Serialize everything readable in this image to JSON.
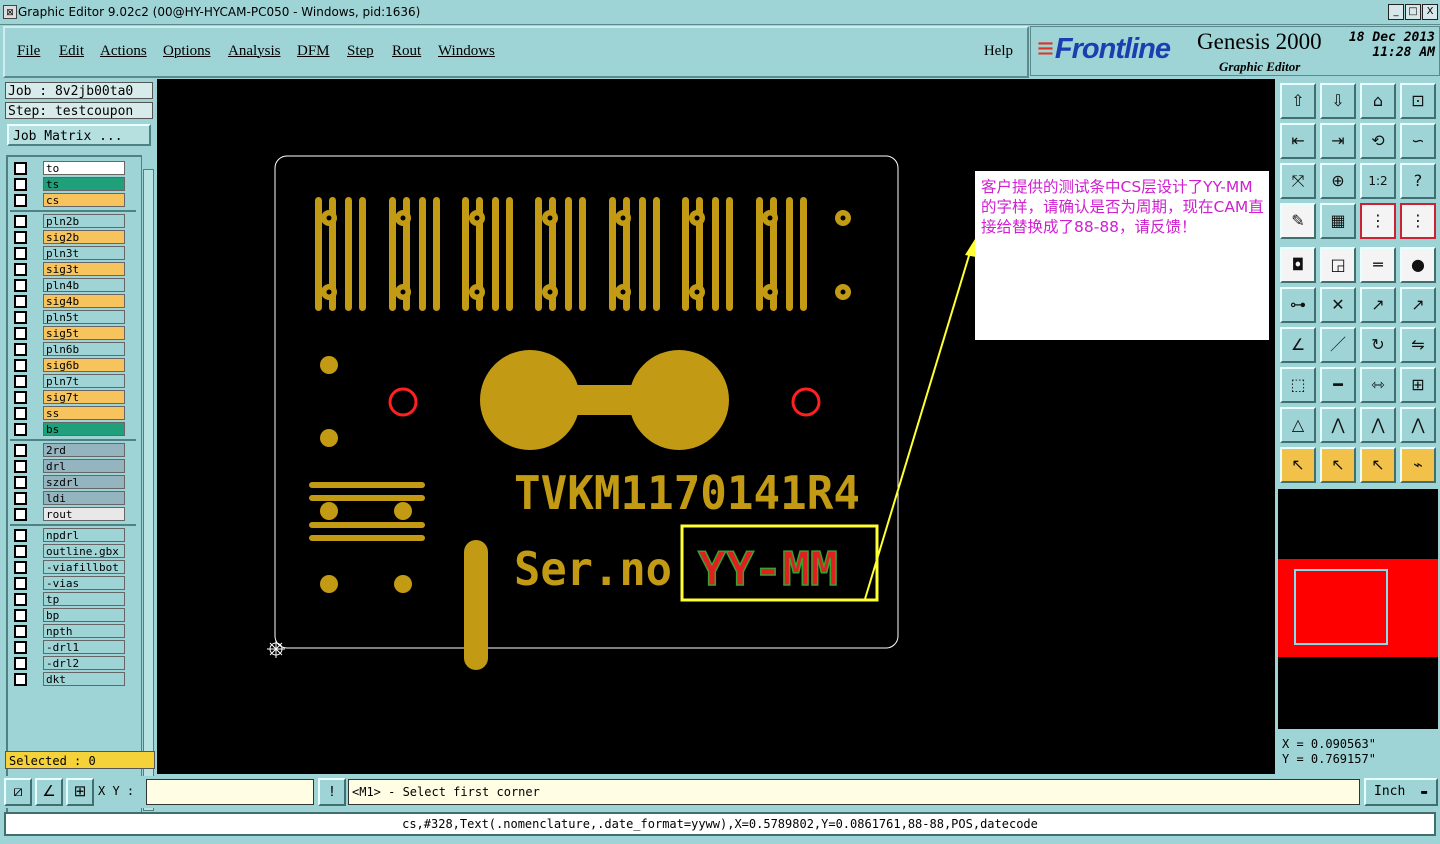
{
  "window": {
    "title": "Graphic Editor 9.02c2 (00@HY-HYCAM-PC050 - Windows, pid:1636)",
    "controls": [
      "_",
      "□",
      "X"
    ]
  },
  "menu": {
    "items": [
      "File",
      "Edit",
      "Actions",
      "Options",
      "Analysis",
      "DFM",
      "Step",
      "Rout",
      "Windows"
    ],
    "help": "Help"
  },
  "brand": {
    "logo": "Frontline",
    "product": "Genesis 2000",
    "subtitle": "Graphic Editor",
    "date": "18 Dec 2013",
    "time": "11:28 AM"
  },
  "job": {
    "job_line": "Job : 8v2jb00ta0",
    "step_line": "Step: testcoupon",
    "matrix_button": "Job Matrix ..."
  },
  "layers": [
    {
      "name": "to",
      "color": "#ffffff"
    },
    {
      "name": "ts",
      "color": "#1fa07a"
    },
    {
      "name": "cs",
      "color": "#f6c35c"
    },
    {
      "name": "pln2b",
      "color": "#9fd4d6"
    },
    {
      "name": "sig2b",
      "color": "#f6c35c"
    },
    {
      "name": "pln3t",
      "color": "#9fd4d6"
    },
    {
      "name": "sig3t",
      "color": "#f6c35c"
    },
    {
      "name": "pln4b",
      "color": "#9fd4d6"
    },
    {
      "name": "sig4b",
      "color": "#f6c35c"
    },
    {
      "name": "pln5t",
      "color": "#9fd4d6"
    },
    {
      "name": "sig5t",
      "color": "#f6c35c"
    },
    {
      "name": "pln6b",
      "color": "#9fd4d6"
    },
    {
      "name": "sig6b",
      "color": "#f6c35c"
    },
    {
      "name": "pln7t",
      "color": "#9fd4d6"
    },
    {
      "name": "sig7t",
      "color": "#f6c35c"
    },
    {
      "name": "ss",
      "color": "#f6c35c"
    },
    {
      "name": "bs",
      "color": "#1fa07a"
    },
    {
      "name": "2rd",
      "color": "#94b5bf"
    },
    {
      "name": "drl",
      "color": "#94b5bf"
    },
    {
      "name": "szdrl",
      "color": "#94b5bf"
    },
    {
      "name": "ldi",
      "color": "#94b5bf"
    },
    {
      "name": "rout",
      "color": "#e8e8e8"
    },
    {
      "name": "npdrl",
      "color": "#9fd4d6"
    },
    {
      "name": "outline.gbx",
      "color": "#9fd4d6"
    },
    {
      "name": "-viafillbot",
      "color": "#9fd4d6"
    },
    {
      "name": "-vias",
      "color": "#9fd4d6"
    },
    {
      "name": "tp",
      "color": "#9fd4d6"
    },
    {
      "name": "bp",
      "color": "#9fd4d6"
    },
    {
      "name": "npth",
      "color": "#9fd4d6"
    },
    {
      "name": "-drl1",
      "color": "#9fd4d6"
    },
    {
      "name": "-drl2",
      "color": "#9fd4d6"
    },
    {
      "name": "dkt",
      "color": "#9fd4d6"
    }
  ],
  "selected_label": "Selected : 0",
  "canvas": {
    "part_number": "TVKM1170141R4",
    "serial_label": "Ser.no",
    "date_code_text": "YY-MM",
    "note": "客户提供的测试条中CS层设计了YY-MM的字样，请确认是否为周期，现在CAM直接给替换成了88-88，请反馈！",
    "colors": {
      "copper": "#c39a14",
      "outline": "#ffffff",
      "annotation_box": "#ffff33",
      "note_text": "#d020d0",
      "red_marker": "#ff2020"
    }
  },
  "tools": {
    "icons": [
      "zoom-home-icon",
      "zoom-fit-icon",
      "zoom-profile-icon",
      "zoom-window-icon",
      "pan-left-icon",
      "pan-right-icon",
      "flip-icon",
      "snake-icon",
      "zoom-in-icon",
      "zoom-out-icon",
      "ratio-icon",
      "help-icon",
      "wand-icon",
      "grid-icon",
      "layers-red-icon",
      "layers-dark-icon",
      "feature-select-icon",
      "box-icon",
      "ruler-icon",
      "dot-icon",
      "net-icon",
      "cross-icon",
      "connect-icon",
      "arrow-dot-icon",
      "line-icon",
      "slash-icon",
      "rotate-icon",
      "mirror-icon",
      "move-icon",
      "minus-icon",
      "measure-icon",
      "pad-icon",
      "triangle-icon",
      "arc-icon",
      "arc2-icon",
      "arc3-icon",
      "pointer-icon",
      "pointer-box-icon",
      "pointer-circle-icon",
      "route-icon"
    ]
  },
  "coords": {
    "x": "X = 0.090563\"",
    "y": "Y = 0.769157\""
  },
  "statusbar": {
    "xy_label": "X Y :",
    "xy_value": "",
    "prompt": "<M1> - Select first corner",
    "unit": "Inch"
  },
  "footer": "cs,#328,Text(.nomenclature,.date_format=yyww),X=0.5789802,Y=0.0861761,88-88,POS,datecode"
}
